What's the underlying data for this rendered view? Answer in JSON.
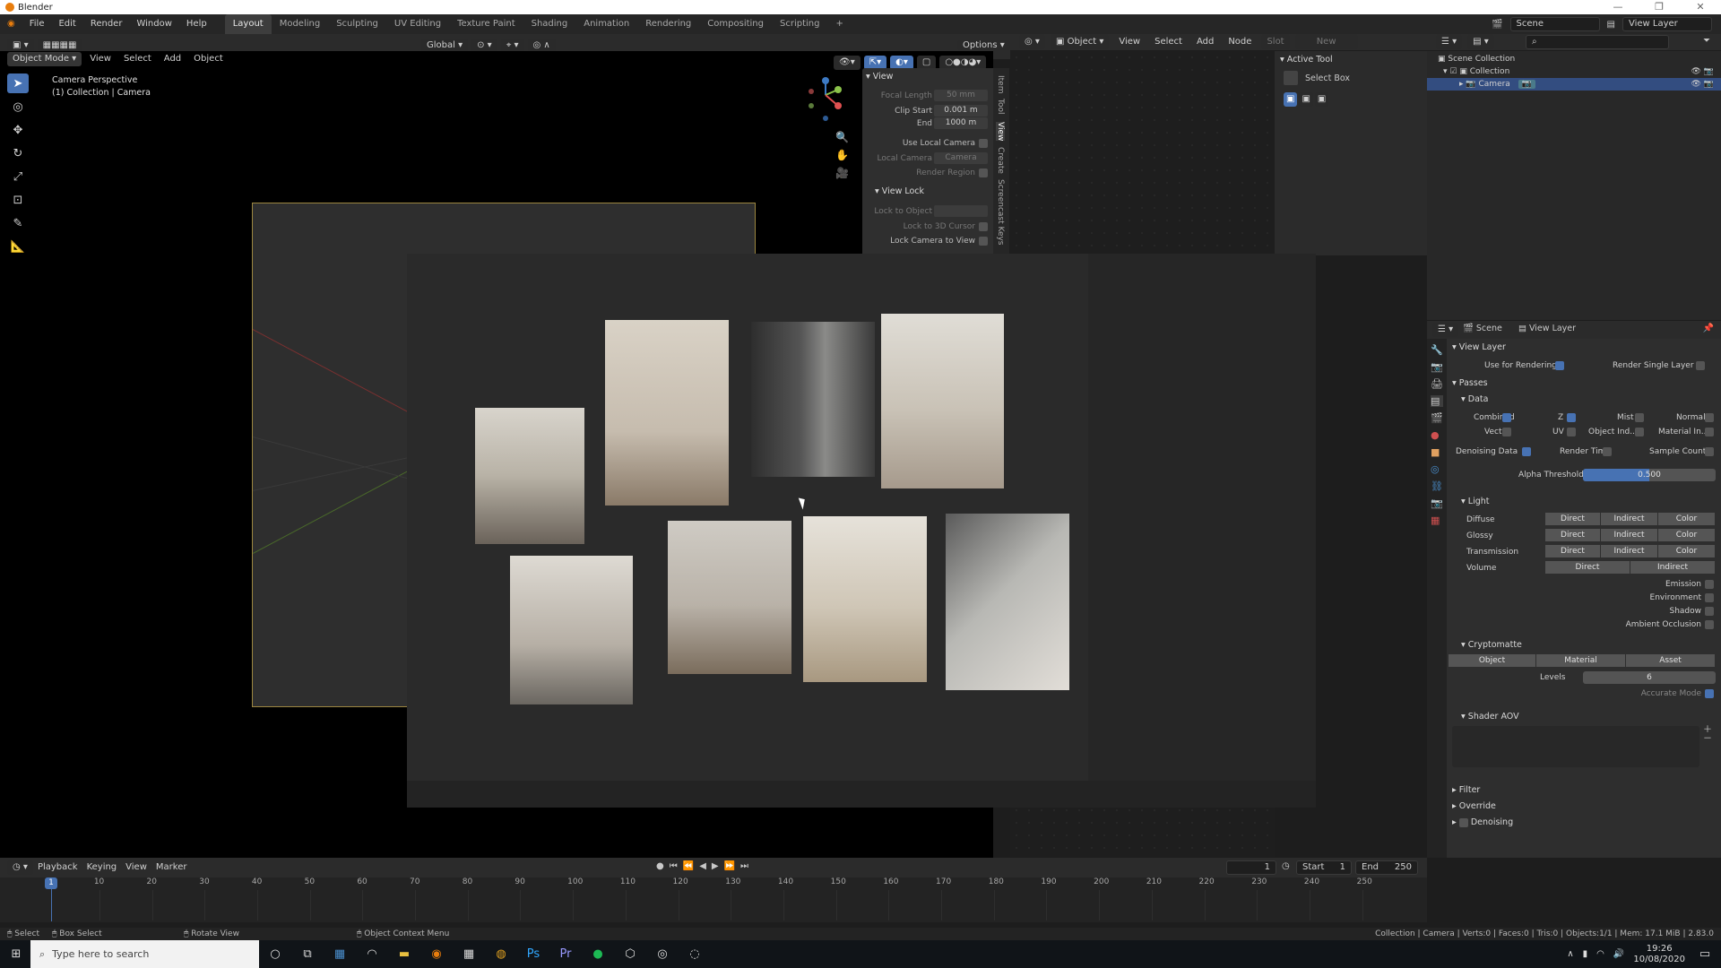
{
  "window": {
    "title": "Blender",
    "controls": [
      "—",
      "❐",
      "✕"
    ]
  },
  "menu": {
    "items": [
      "File",
      "Edit",
      "Render",
      "Window",
      "Help"
    ]
  },
  "workspaces": [
    "Layout",
    "Modeling",
    "Sculpting",
    "UV Editing",
    "Texture Paint",
    "Shading",
    "Animation",
    "Rendering",
    "Compositing",
    "Scripting",
    "+"
  ],
  "topright": {
    "scene_label": "Scene",
    "view_layer_label": "View Layer"
  },
  "viewport": {
    "mode": "Object Mode",
    "menus": [
      "View",
      "Select",
      "Add",
      "Object"
    ],
    "transform": "Global",
    "options": "Options",
    "overlay_title": "Camera Perspective",
    "overlay_subtitle": "(1) Collection | Camera"
  },
  "npanel": {
    "section": "View",
    "focal_length_label": "Focal Length",
    "focal_length": "50 mm",
    "clip_start_label": "Clip Start",
    "clip_start": "0.001 m",
    "end_label": "End",
    "end": "1000 m",
    "use_local_camera": "Use Local Camera",
    "local_camera_label": "Local Camera",
    "local_camera": "Camera",
    "render_region": "Render Region",
    "view_lock": "View Lock",
    "lock_to_object": "Lock to Object",
    "lock_to_cursor": "Lock to 3D Cursor",
    "lock_camera": "Lock Camera to View",
    "tabs": [
      "Item",
      "Tool",
      "View",
      "Create",
      "Screencast Keys"
    ]
  },
  "node_editor": {
    "mode": "Object",
    "menus": [
      "View",
      "Select",
      "Add",
      "Node"
    ],
    "slot": "Slot",
    "new": "New"
  },
  "active_tool": {
    "title": "Active Tool",
    "tool": "Select Box"
  },
  "outliner": {
    "rows": [
      {
        "label": "Scene Collection"
      },
      {
        "label": "Collection"
      },
      {
        "label": "Camera"
      }
    ]
  },
  "properties": {
    "scene": "Scene",
    "view_layer": "View Layer",
    "section_view_layer": "View Layer",
    "use_for_rendering": "Use for Rendering",
    "render_single_layer": "Render Single Layer",
    "passes": "Passes",
    "data": "Data",
    "combined": "Combined",
    "z": "Z",
    "mist": "Mist",
    "normal": "Normal",
    "vector": "Vector",
    "uv": "UV",
    "object_index": "Object Ind...",
    "material_index": "Material In...",
    "denoising_data": "Denoising Data",
    "render_time": "Render Time",
    "sample_count": "Sample Count",
    "alpha_threshold_label": "Alpha Threshold",
    "alpha_threshold": "0.500",
    "light": "Light",
    "light_rows": [
      {
        "label": "Diffuse",
        "buttons": [
          "Direct",
          "Indirect",
          "Color"
        ]
      },
      {
        "label": "Glossy",
        "buttons": [
          "Direct",
          "Indirect",
          "Color"
        ]
      },
      {
        "label": "Transmission",
        "buttons": [
          "Direct",
          "Indirect",
          "Color"
        ]
      },
      {
        "label": "Volume",
        "buttons": [
          "Direct",
          "Indirect"
        ]
      }
    ],
    "emission": "Emission",
    "environment": "Environment",
    "shadow": "Shadow",
    "ambient_occlusion": "Ambient Occlusion",
    "cryptomatte": "Cryptomatte",
    "crypto_buttons": [
      "Object",
      "Material",
      "Asset"
    ],
    "levels_label": "Levels",
    "levels": "6",
    "accurate_mode": "Accurate Mode",
    "shader_aov": "Shader AOV",
    "filter": "Filter",
    "override": "Override",
    "denoising": "Denoising"
  },
  "timeline": {
    "menus": [
      "Playback",
      "Keying",
      "View",
      "Marker"
    ],
    "current_frame": "1",
    "start_label": "Start",
    "start": "1",
    "end_label": "End",
    "end": "250",
    "ticks": [
      "10",
      "20",
      "30",
      "40",
      "50",
      "60",
      "70",
      "80",
      "90",
      "100",
      "110",
      "120",
      "130",
      "140",
      "150",
      "160",
      "170",
      "180",
      "190",
      "200",
      "210",
      "220",
      "230",
      "240",
      "250"
    ]
  },
  "status": {
    "select": "Select",
    "box_select": "Box Select",
    "rotate_view": "Rotate View",
    "context_menu": "Object Context Menu",
    "stats": "Collection | Camera | Verts:0 | Faces:0 | Tris:0 | Objects:1/1 | Mem: 17.1 MiB | 2.83.0"
  },
  "taskbar": {
    "search_placeholder": "Type here to search",
    "time": "19:26",
    "date": "10/08/2020"
  }
}
